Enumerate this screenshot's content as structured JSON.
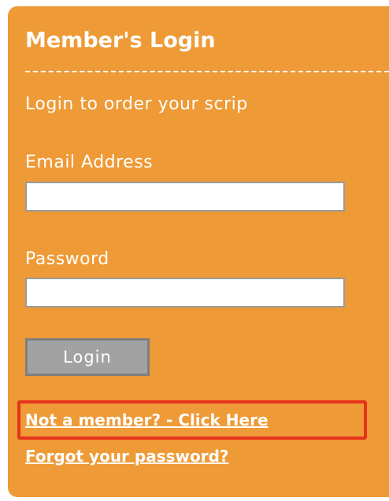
{
  "login_box": {
    "title": "Member's Login",
    "subtitle": "Login to order your scrip",
    "email": {
      "label": "Email Address",
      "value": "",
      "placeholder": ""
    },
    "password": {
      "label": "Password",
      "value": "",
      "placeholder": ""
    },
    "login_button_label": "Login",
    "links": {
      "not_member": "Not a member? - Click Here",
      "forgot_password": "Forgot your password?"
    }
  },
  "colors": {
    "panel_background": "#ee9a36",
    "text": "#ffffff",
    "button_background": "#a2a2a2",
    "highlight_border": "#e6331b"
  }
}
